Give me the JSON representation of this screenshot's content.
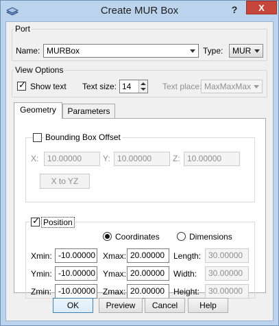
{
  "window": {
    "title": "Create MUR Box",
    "help_glyph": "?",
    "close_glyph": "X",
    "icon_name": "app-icon",
    "colors": {
      "title_bar": "#bcd3ee",
      "close_button": "#c7463c"
    }
  },
  "port": {
    "group_title": "Port",
    "name_label": "Name:",
    "name_value": "MURBox",
    "type_label": "Type:",
    "type_value": "MUR"
  },
  "view_options": {
    "group_title": "View Options",
    "show_text_label": "Show text",
    "show_text_checked": true,
    "text_size_label": "Text size:",
    "text_size_value": "14",
    "text_place_label": "Text place:",
    "text_place_value": "MaxMaxMax"
  },
  "tabs": [
    {
      "label": "Geometry",
      "active": true
    },
    {
      "label": "Parameters",
      "active": false
    }
  ],
  "bounding_box": {
    "title": "Bounding Box Offset",
    "checked": false,
    "x_label": "X:",
    "x_value": "10.00000",
    "y_label": "Y:",
    "y_value": "10.00000",
    "z_label": "Z:",
    "z_value": "10.00000",
    "x_to_yz_label": "X to YZ"
  },
  "position": {
    "title": "Position",
    "checked": true,
    "mode_coordinates": "Coordinates",
    "mode_dimensions": "Dimensions",
    "selected_mode": "Coordinates",
    "rows": [
      {
        "min_label": "Xmin:",
        "min_value": "-10.00000",
        "max_label": "Xmax:",
        "max_value": "20.00000",
        "dim_label": "Length:",
        "dim_value": "30.00000"
      },
      {
        "min_label": "Ymin:",
        "min_value": "-10.00000",
        "max_label": "Ymax:",
        "max_value": "20.00000",
        "dim_label": "Width:",
        "dim_value": "30.00000"
      },
      {
        "min_label": "Zmin:",
        "min_value": "-10.00000",
        "max_label": "Zmax:",
        "max_value": "20.00000",
        "dim_label": "Height:",
        "dim_value": "30.00000"
      }
    ]
  },
  "buttons": {
    "ok": "OK",
    "preview": "Preview",
    "cancel": "Cancel",
    "help": "Help"
  }
}
